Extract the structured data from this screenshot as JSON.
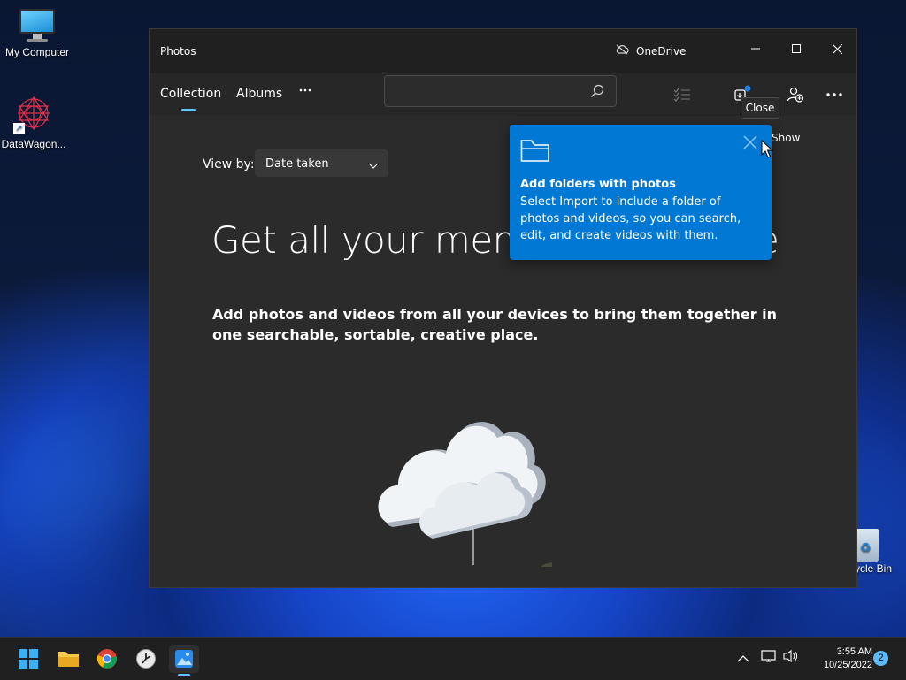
{
  "desktop": {
    "icons": [
      {
        "label": "My Computer"
      },
      {
        "label": "DataWagon..."
      },
      {
        "label": "cycle Bin"
      }
    ]
  },
  "window": {
    "app_title": "Photos",
    "onedrive_label": "OneDrive",
    "tabs": [
      {
        "label": "Collection"
      },
      {
        "label": "Albums"
      }
    ],
    "search": {
      "value": "",
      "placeholder": ""
    },
    "view_by_label": "View by:",
    "view_by_value": "Date taken",
    "headline": "Get all your memo",
    "headline_tail": "e",
    "subtext": "Add photos and videos from all your devices to bring them together in one searchable, sortable, creative place.",
    "show_label": "Show"
  },
  "tooltip": {
    "text": "Close"
  },
  "teaching_tip": {
    "title": "Add folders with photos",
    "body": "Select Import to include a folder of photos and videos, so you can search, edit, and create videos with them."
  },
  "taskbar": {
    "time": "3:55 AM",
    "date": "10/25/2022",
    "notification_count": "2"
  },
  "colors": {
    "accent": "#0078d4",
    "tab_indicator": "#5cc8ff",
    "window_bg": "#202020",
    "content_bg": "#2b2b2b"
  }
}
